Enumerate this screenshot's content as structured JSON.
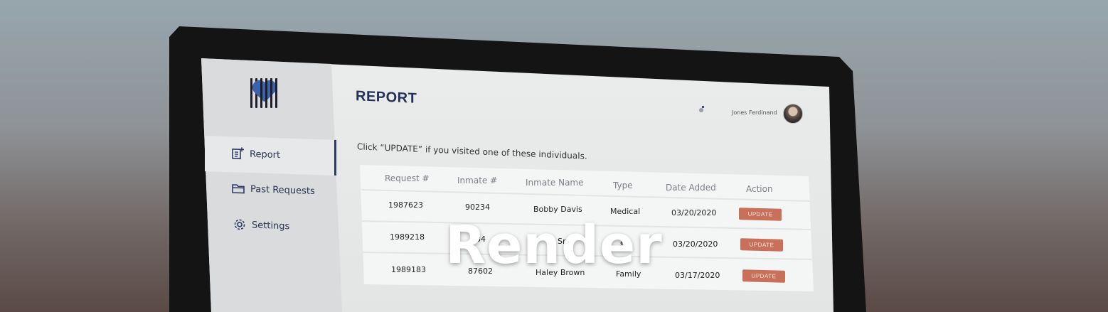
{
  "app": {
    "page_title": "REPORT",
    "instruction": "Click “UPDATE” if you visited one of these individuals.",
    "user_name": "Jones Ferdinand"
  },
  "sidebar": {
    "items": [
      {
        "label": "Report",
        "icon": "report-icon",
        "active": true
      },
      {
        "label": "Past Requests",
        "icon": "folder-icon",
        "active": false
      },
      {
        "label": "Settings",
        "icon": "gear-icon",
        "active": false
      }
    ]
  },
  "table": {
    "headers": [
      "Request #",
      "Inmate #",
      "Inmate Name",
      "Type",
      "Date Added",
      "Action"
    ],
    "rows": [
      {
        "request": "1987623",
        "inmate": "90234",
        "name": "Bobby Davis",
        "type": "Medical",
        "date": "03/20/2020",
        "action": "UPDATE"
      },
      {
        "request": "1989218",
        "inmate": "834",
        "name": "Sm",
        "type": "ed",
        "date": "03/20/2020",
        "action": "UPDATE"
      },
      {
        "request": "1989183",
        "inmate": "87602",
        "name": "Haley Brown",
        "type": "Family",
        "date": "03/17/2020",
        "action": "UPDATE"
      }
    ]
  },
  "overlay": {
    "title": "Render"
  },
  "colors": {
    "accent": "#25305a",
    "update_button": "#c9705a"
  }
}
